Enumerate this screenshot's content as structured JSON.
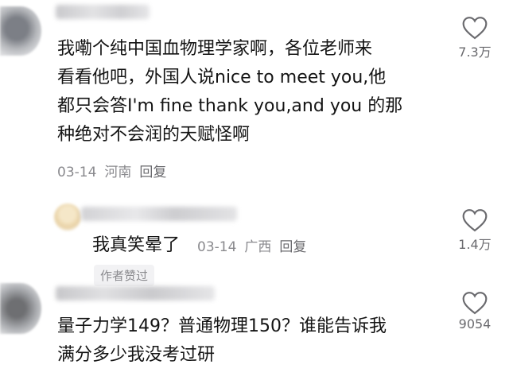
{
  "comments": [
    {
      "text": "我嘞个纯中国血物理学家啊，各位老师来\n看看他吧，外国人说nice to meet you,他\n都只会答I'm fine thank you,and you 的那\n种绝对不会润的天赋怪啊",
      "date": "03-14",
      "location": "河南",
      "reply_label": "回复",
      "likes": "7.3万",
      "icon": "heart-outline-icon"
    },
    {
      "text": "我真笑晕了",
      "date": "03-14",
      "location": "广西",
      "reply_label": "回复",
      "likes": "1.4万",
      "badge": "作者赞过",
      "icon": "heart-outline-icon"
    },
    {
      "text": "量子力学149？普通物理150？谁能告诉我\n满分多少我没考过研",
      "likes": "9054",
      "icon": "heart-outline-icon"
    }
  ]
}
